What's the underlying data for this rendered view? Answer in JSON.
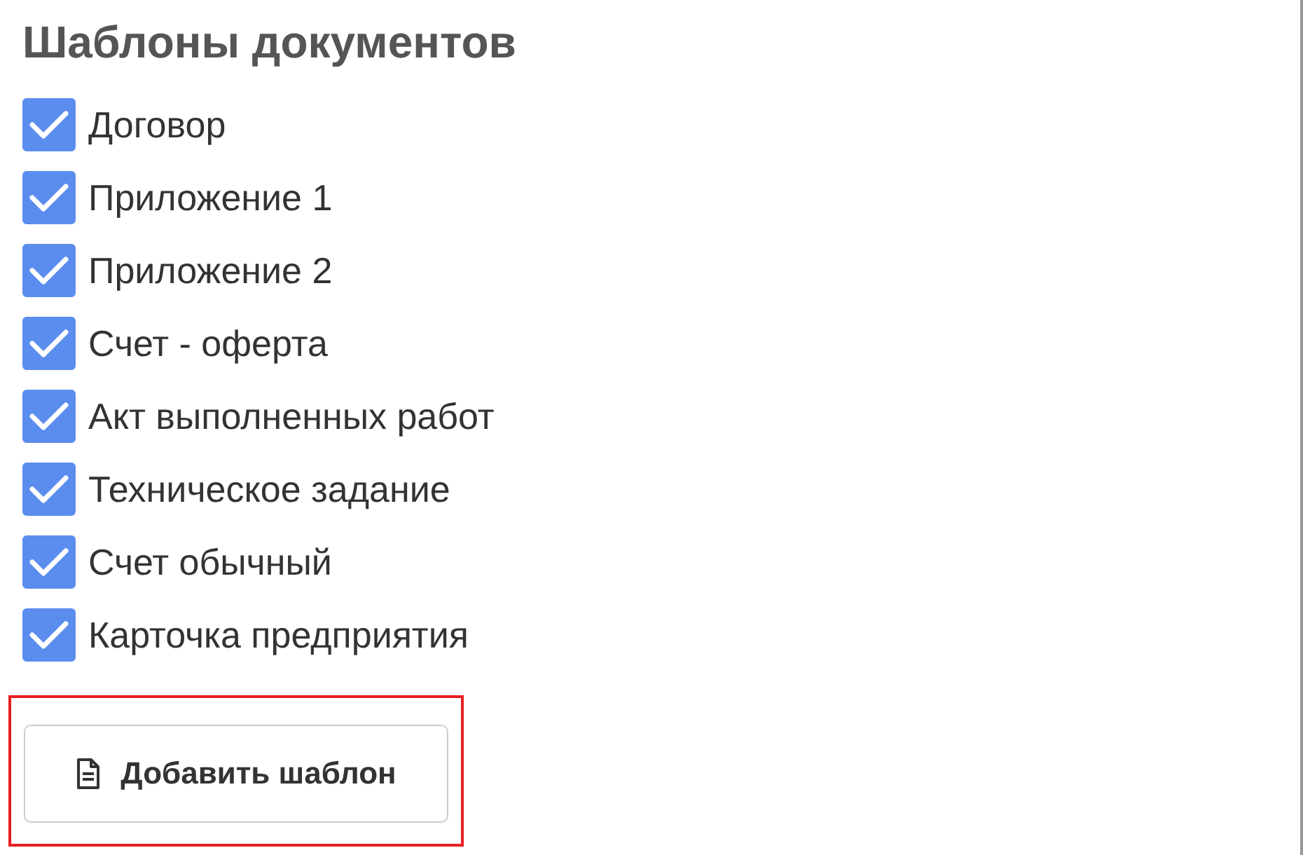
{
  "title": "Шаблоны документов",
  "templates": [
    {
      "label": "Договор",
      "checked": true
    },
    {
      "label": "Приложение 1",
      "checked": true
    },
    {
      "label": "Приложение 2",
      "checked": true
    },
    {
      "label": "Счет - оферта",
      "checked": true
    },
    {
      "label": "Акт выполненных работ",
      "checked": true
    },
    {
      "label": "Техническое задание",
      "checked": true
    },
    {
      "label": "Счет обычный",
      "checked": true
    },
    {
      "label": "Карточка предприятия",
      "checked": true
    }
  ],
  "add_button": {
    "label": "Добавить шаблон"
  }
}
